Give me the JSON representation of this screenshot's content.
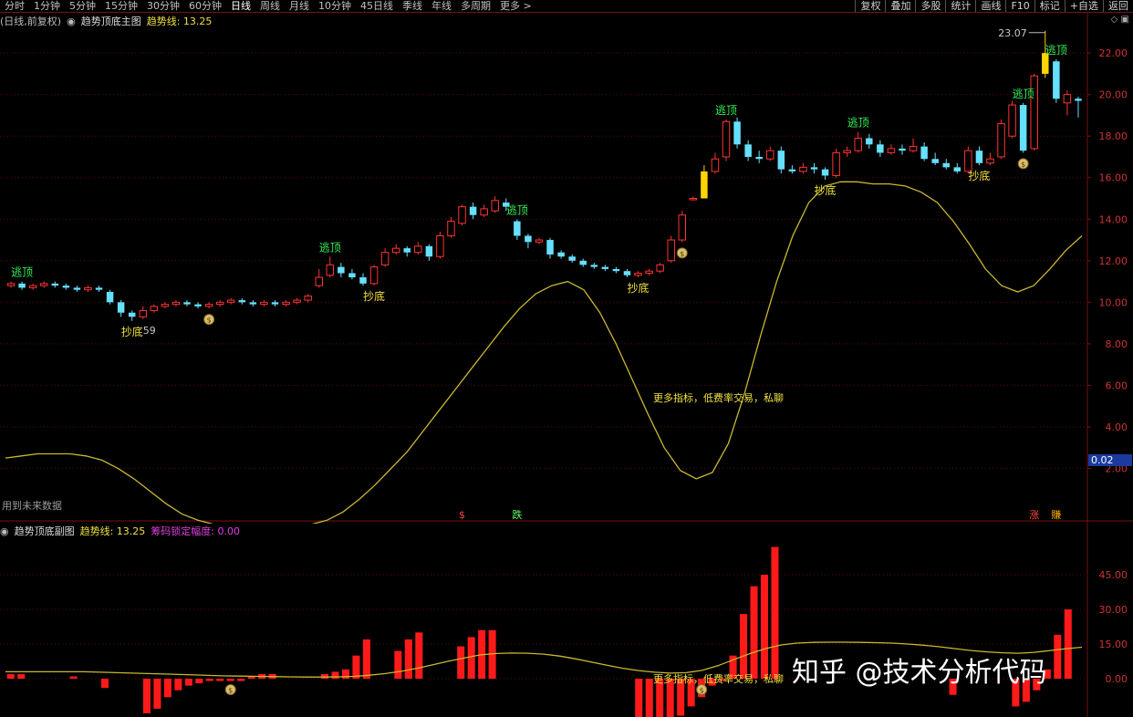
{
  "toolbar": {
    "periods": [
      "分时",
      "1分钟",
      "5分钟",
      "15分钟",
      "30分钟",
      "60分钟",
      "日线",
      "周线",
      "月线",
      "10分钟",
      "45日线",
      "季线",
      "年线",
      "多周期",
      "更多 >"
    ],
    "active_period": "日线",
    "buttons": [
      "复权",
      "叠加",
      "多股",
      "统计",
      "画线",
      "F10",
      "标记",
      "+自选",
      "返回"
    ]
  },
  "main_panel": {
    "period_label": "(日线,前复权)",
    "indicator_name": "趋势顶底主图",
    "trend_line_label": "趋势线: 13.25",
    "future_note": "用到未来数据",
    "promo_text": "更多指标，低费率交易，私聊",
    "max_label": "23.07",
    "min_label": "59"
  },
  "sub_panel": {
    "indicator_name": "趋势顶底副图",
    "trend_line_label": "趋势线: 13.25",
    "chip_label": "筹码锁定幅度: 0.00",
    "promo_text": "更多指标，低费率交易，私聊"
  },
  "watermark": "知乎 @技术分析代码",
  "chart_data": [
    {
      "type": "candlestick",
      "title": "",
      "ylim": [
        0,
        23.5
      ],
      "y_ticks": [
        "22.00",
        "20.00",
        "18.00",
        "16.00",
        "14.00",
        "12.00",
        "10.00",
        "8.00",
        "6.00",
        "4.00",
        "2.00"
      ],
      "current_value_tag": "0.02",
      "colors": {
        "up": "#ff3333",
        "down": "#66e0ff",
        "highlight": "#ffd400",
        "trend": "#c8b830"
      },
      "candles": [
        [
          10.8,
          10.9,
          11.0,
          10.7
        ],
        [
          10.9,
          10.7,
          11.0,
          10.6
        ],
        [
          10.7,
          10.8,
          10.9,
          10.6
        ],
        [
          10.8,
          10.9,
          11.0,
          10.7
        ],
        [
          10.9,
          10.8,
          11.0,
          10.7
        ],
        [
          10.8,
          10.7,
          10.9,
          10.6
        ],
        [
          10.7,
          10.6,
          10.8,
          10.5
        ],
        [
          10.6,
          10.7,
          10.8,
          10.5
        ],
        [
          10.7,
          10.6,
          10.8,
          10.5
        ],
        [
          10.5,
          10.0,
          10.6,
          9.9
        ],
        [
          10.0,
          9.5,
          10.1,
          9.3
        ],
        [
          9.5,
          9.3,
          9.6,
          9.1
        ],
        [
          9.3,
          9.6,
          9.8,
          9.2
        ],
        [
          9.6,
          9.8,
          9.9,
          9.5
        ],
        [
          9.8,
          9.9,
          10.0,
          9.7
        ],
        [
          9.9,
          10.0,
          10.1,
          9.8
        ],
        [
          10.0,
          9.9,
          10.1,
          9.8
        ],
        [
          9.9,
          9.8,
          10.0,
          9.7
        ],
        [
          9.8,
          9.9,
          10.0,
          9.7
        ],
        [
          9.9,
          10.0,
          10.1,
          9.8
        ],
        [
          10.0,
          10.1,
          10.2,
          9.9
        ],
        [
          10.1,
          10.0,
          10.2,
          9.9
        ],
        [
          10.0,
          9.9,
          10.1,
          9.8
        ],
        [
          9.9,
          10.0,
          10.1,
          9.8
        ],
        [
          10.0,
          9.9,
          10.1,
          9.8
        ],
        [
          9.9,
          10.0,
          10.1,
          9.8
        ],
        [
          10.0,
          10.1,
          10.2,
          9.9
        ],
        [
          10.1,
          10.3,
          10.4,
          10.0
        ],
        [
          10.8,
          11.2,
          11.6,
          10.7
        ],
        [
          11.3,
          11.8,
          12.2,
          11.2
        ],
        [
          11.7,
          11.4,
          11.9,
          11.2
        ],
        [
          11.4,
          11.2,
          11.6,
          11.1
        ],
        [
          11.2,
          10.9,
          11.4,
          10.8
        ],
        [
          10.9,
          11.7,
          11.8,
          10.8
        ],
        [
          11.8,
          12.4,
          12.6,
          11.7
        ],
        [
          12.4,
          12.6,
          12.8,
          12.3
        ],
        [
          12.6,
          12.4,
          12.7,
          12.2
        ],
        [
          12.4,
          12.7,
          12.9,
          12.3
        ],
        [
          12.7,
          12.2,
          12.8,
          12.0
        ],
        [
          12.2,
          13.2,
          13.4,
          12.1
        ],
        [
          13.2,
          13.9,
          14.1,
          13.1
        ],
        [
          13.8,
          14.6,
          14.7,
          13.7
        ],
        [
          14.6,
          14.2,
          14.8,
          14.0
        ],
        [
          14.2,
          14.5,
          14.7,
          14.1
        ],
        [
          14.4,
          14.9,
          15.1,
          14.3
        ],
        [
          14.8,
          14.6,
          15.0,
          14.4
        ],
        [
          13.9,
          13.2,
          14.0,
          13.0
        ],
        [
          13.2,
          12.9,
          13.3,
          12.6
        ],
        [
          12.9,
          13.0,
          13.1,
          12.8
        ],
        [
          13.0,
          12.3,
          13.1,
          12.1
        ],
        [
          12.4,
          12.2,
          12.5,
          12.1
        ],
        [
          12.2,
          12.0,
          12.3,
          11.9
        ],
        [
          12.0,
          11.8,
          12.1,
          11.7
        ],
        [
          11.8,
          11.7,
          11.9,
          11.6
        ],
        [
          11.7,
          11.6,
          11.8,
          11.5
        ],
        [
          11.6,
          11.5,
          11.7,
          11.4
        ],
        [
          11.5,
          11.3,
          11.6,
          11.2
        ],
        [
          11.3,
          11.4,
          11.5,
          11.2
        ],
        [
          11.4,
          11.5,
          11.6,
          11.3
        ],
        [
          11.5,
          11.8,
          11.9,
          11.4
        ],
        [
          12.0,
          13.0,
          13.2,
          11.9
        ],
        [
          13.0,
          14.2,
          14.4,
          12.9
        ],
        [
          15.0,
          15.0,
          15.1,
          14.9
        ],
        [
          15.0,
          16.3,
          16.6,
          15.0
        ],
        [
          16.3,
          16.9,
          17.2,
          16.2
        ],
        [
          17.0,
          18.7,
          18.8,
          16.8
        ],
        [
          18.7,
          17.6,
          18.9,
          17.4
        ],
        [
          17.6,
          17.0,
          17.8,
          16.8
        ],
        [
          17.0,
          16.9,
          17.3,
          16.7
        ],
        [
          16.9,
          17.3,
          17.5,
          16.8
        ],
        [
          17.3,
          16.4,
          17.5,
          16.2
        ],
        [
          16.4,
          16.3,
          16.6,
          16.2
        ],
        [
          16.3,
          16.5,
          16.7,
          16.2
        ],
        [
          16.5,
          16.4,
          16.7,
          16.2
        ],
        [
          16.4,
          16.1,
          16.5,
          15.9
        ],
        [
          16.1,
          17.2,
          17.4,
          16.0
        ],
        [
          17.2,
          17.3,
          17.5,
          17.0
        ],
        [
          17.3,
          17.9,
          18.2,
          17.2
        ],
        [
          17.9,
          17.6,
          18.1,
          17.4
        ],
        [
          17.6,
          17.2,
          17.8,
          17.0
        ],
        [
          17.2,
          17.4,
          17.6,
          17.1
        ],
        [
          17.4,
          17.3,
          17.6,
          17.1
        ],
        [
          17.3,
          17.5,
          17.9,
          17.2
        ],
        [
          17.5,
          16.9,
          17.7,
          16.8
        ],
        [
          16.9,
          16.7,
          17.2,
          16.6
        ],
        [
          16.7,
          16.5,
          16.9,
          16.4
        ],
        [
          16.5,
          16.3,
          16.7,
          16.2
        ],
        [
          16.3,
          17.3,
          17.5,
          16.2
        ],
        [
          17.3,
          16.7,
          17.5,
          16.6
        ],
        [
          16.7,
          16.9,
          17.2,
          16.6
        ],
        [
          17.0,
          18.6,
          18.8,
          16.9
        ],
        [
          18.0,
          19.5,
          19.7,
          17.9
        ],
        [
          19.5,
          17.3,
          19.6,
          17.2
        ],
        [
          17.4,
          20.9,
          21.0,
          17.3
        ],
        [
          21.0,
          22.0,
          23.07,
          20.8
        ],
        [
          21.6,
          19.8,
          21.7,
          19.6
        ],
        [
          19.6,
          20.0,
          20.2,
          19.0
        ],
        [
          19.8,
          19.7,
          19.9,
          18.9
        ]
      ],
      "highlight_indices": [
        63,
        94
      ],
      "trend_line": [
        2.5,
        2.6,
        2.7,
        2.7,
        2.7,
        2.6,
        2.4,
        2.0,
        1.5,
        0.9,
        0.3,
        -0.2,
        -0.5,
        -0.7,
        -0.8,
        -0.9,
        -0.9,
        -0.9,
        -0.8,
        -0.7,
        -0.5,
        -0.1,
        0.5,
        1.2,
        2.0,
        2.8,
        3.8,
        4.8,
        5.8,
        6.8,
        7.8,
        8.8,
        9.7,
        10.4,
        10.8,
        11.0,
        10.6,
        9.5,
        8.0,
        6.3,
        4.6,
        3.0,
        1.9,
        1.5,
        1.8,
        3.2,
        5.6,
        8.4,
        11.0,
        13.2,
        14.8,
        15.6,
        15.8,
        15.8,
        15.7,
        15.7,
        15.6,
        15.3,
        14.8,
        13.9,
        12.8,
        11.6,
        10.8,
        10.5,
        10.8,
        11.6,
        12.5,
        13.2
      ],
      "annotations": [
        {
          "text": "逃顶",
          "type": "top",
          "candle": 1
        },
        {
          "text": "抄底",
          "type": "bottom",
          "candle": 11
        },
        {
          "text": "逃顶",
          "type": "top",
          "candle": 29
        },
        {
          "text": "抄底",
          "type": "bottom",
          "candle": 33
        },
        {
          "text": "逃顶",
          "type": "top",
          "candle": 46
        },
        {
          "text": "抄底",
          "type": "bottom",
          "candle": 57
        },
        {
          "text": "逃顶",
          "type": "top",
          "candle": 65
        },
        {
          "text": "抄底",
          "type": "bottom",
          "candle": 74
        },
        {
          "text": "逃顶",
          "type": "top",
          "candle": 77
        },
        {
          "text": "抄底",
          "type": "bottom",
          "candle": 88
        },
        {
          "text": "逃顶",
          "type": "top",
          "candle": 92
        },
        {
          "text": "逃顶",
          "type": "top",
          "candle": 95
        }
      ],
      "bottom_markers": [
        {
          "text": "$",
          "candle": 41,
          "color": "#ff4444"
        },
        {
          "text": "跌",
          "candle": 46,
          "color": "#66ff66"
        },
        {
          "text": "涨",
          "candle": 93,
          "color": "#ff4444"
        },
        {
          "text": "賺",
          "candle": 95,
          "color": "#ffb000"
        }
      ],
      "money_bag_indices": [
        18,
        61,
        92
      ]
    },
    {
      "type": "bar",
      "title": "",
      "ylim": [
        -15,
        60
      ],
      "y_ticks": [
        "45.00",
        "30.00",
        "15.00",
        "0.00"
      ],
      "colors": {
        "bar": "#ff1a1a",
        "line": "#c8b830"
      },
      "values": [
        2,
        2,
        0,
        0,
        0,
        0,
        1,
        0,
        0,
        -4,
        0,
        0,
        0,
        -15,
        -13,
        -8,
        -5,
        -3,
        -2,
        -1,
        -1,
        -1,
        -1,
        1,
        2,
        2,
        0,
        0,
        0,
        0,
        2,
        3,
        4,
        10,
        17,
        0,
        0,
        12,
        17,
        20,
        0,
        0,
        0,
        14,
        18,
        21,
        21,
        0,
        0,
        0,
        0,
        0,
        0,
        0,
        0,
        0,
        0,
        0,
        0,
        0,
        -24,
        -24,
        -22,
        -19,
        -16,
        -12,
        -8,
        -3,
        -1,
        10,
        28,
        40,
        45,
        57,
        0,
        0,
        0,
        0,
        0,
        0,
        0,
        0,
        0,
        0,
        0,
        0,
        0,
        0,
        0,
        0,
        -7,
        0,
        0,
        0,
        0,
        0,
        -12,
        -10,
        -5,
        4,
        19,
        30,
        0
      ],
      "trend_line": [
        3,
        3,
        3,
        3,
        3,
        3,
        2.8,
        2.6,
        2.4,
        2.2,
        2,
        1.8,
        1.6,
        1.4,
        1.2,
        1.1,
        1,
        0.9,
        0.8,
        0.7,
        0.7,
        0.8,
        1,
        1.5,
        2.2,
        3.2,
        4.5,
        6,
        7.6,
        9,
        10.3,
        10.9,
        11.1,
        11,
        10.6,
        9.8,
        8.6,
        7.2,
        5.8,
        4.5,
        3.5,
        2.8,
        2.4,
        2.6,
        3.6,
        5.6,
        8.2,
        10.8,
        13,
        14.6,
        15.4,
        15.7,
        15.8,
        15.8,
        15.7,
        15.6,
        15.4,
        15,
        14.5,
        13.8,
        13,
        12.2,
        11.6,
        11.2,
        11,
        11.4,
        12.2,
        13,
        13.6
      ]
    }
  ]
}
